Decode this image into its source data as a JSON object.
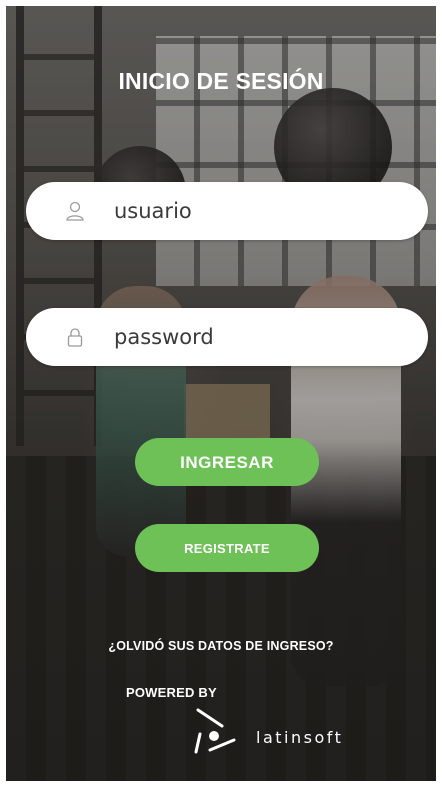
{
  "header": {
    "title": "INICIO DE SESIÓN"
  },
  "form": {
    "username": {
      "placeholder": "usuario",
      "value": "",
      "icon": "user-icon"
    },
    "password": {
      "placeholder": "password",
      "value": "",
      "icon": "lock-icon"
    },
    "login_label": "INGRESAR",
    "register_label": "REGISTRATE",
    "forgot_label": "¿OLVIDÓ SUS DATOS DE INGRESO?"
  },
  "footer": {
    "powered_by": "POWERED BY",
    "brand_name": "latinsoft",
    "logo_icon": "latinsoft-logo"
  },
  "colors": {
    "accent": "#6ec157",
    "text_light": "#ffffff",
    "field_bg": "#ffffff"
  }
}
